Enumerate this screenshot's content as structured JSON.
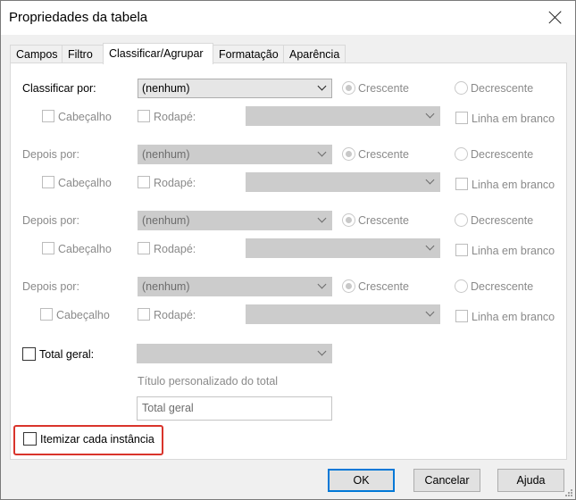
{
  "window": {
    "title": "Propriedades da tabela"
  },
  "tabs": [
    {
      "label": "Campos"
    },
    {
      "label": "Filtro"
    },
    {
      "label": "Classificar/Agrupar"
    },
    {
      "label": "Formatação"
    },
    {
      "label": "Aparência"
    }
  ],
  "active_tab": "Classificar/Agrupar",
  "sort_levels": [
    {
      "label": "Classificar por:",
      "value": "(nenhum)",
      "asc": "Crescente",
      "desc": "Decrescente",
      "header": "Cabeçalho",
      "footer": "Rodapé:",
      "blank_line": "Linha em branco"
    },
    {
      "label": "Depois por:",
      "value": "(nenhum)",
      "asc": "Crescente",
      "desc": "Decrescente",
      "header": "Cabeçalho",
      "footer": "Rodapé:",
      "blank_line": "Linha em branco"
    },
    {
      "label": "Depois por:",
      "value": "(nenhum)",
      "asc": "Crescente",
      "desc": "Decrescente",
      "header": "Cabeçalho",
      "footer": "Rodapé:",
      "blank_line": "Linha em branco"
    },
    {
      "label": "Depois por:",
      "value": "(nenhum)",
      "asc": "Crescente",
      "desc": "Decrescente",
      "header": "Cabeçalho",
      "footer": "Rodapé:",
      "blank_line": "Linha em branco"
    }
  ],
  "total": {
    "label": "Total geral:",
    "custom_title_label": "Título personalizado do total",
    "custom_title_value": "Total geral"
  },
  "itemize": {
    "label": "Itemizar cada instância"
  },
  "buttons": {
    "ok": "OK",
    "cancel": "Cancelar",
    "help": "Ajuda"
  },
  "colors": {
    "highlight": "#d9342b",
    "default_button_border": "#0078d7"
  }
}
